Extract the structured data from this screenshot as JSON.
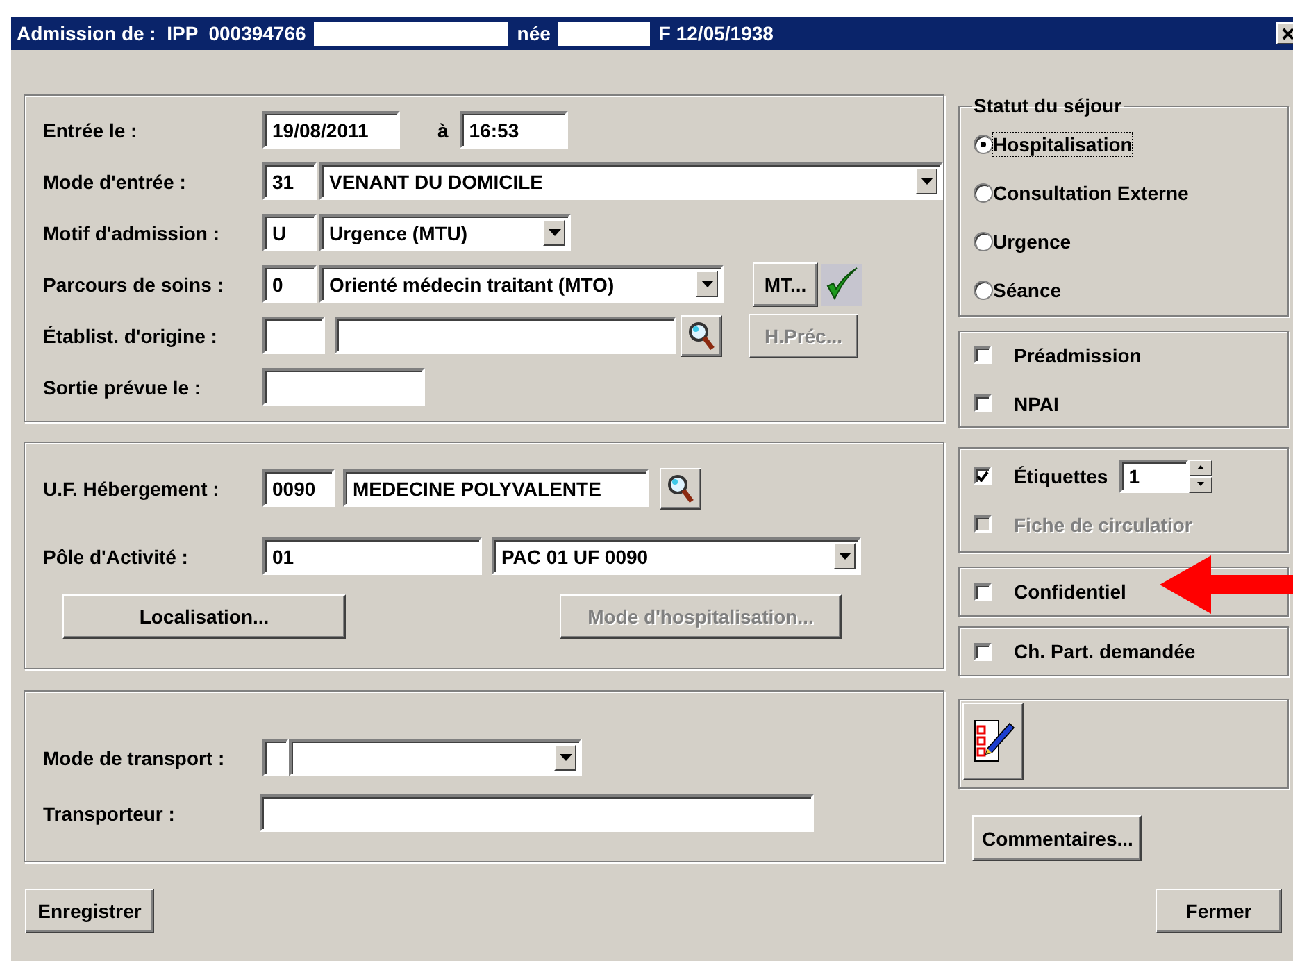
{
  "window": {
    "title": [
      {
        "kind": "text",
        "text": "Admission de :  IPP  000394766"
      },
      {
        "kind": "redacted"
      },
      {
        "kind": "text",
        "text": "née"
      },
      {
        "kind": "redacted"
      },
      {
        "kind": "text",
        "text": "F 12/05/1938"
      }
    ]
  },
  "admission_panel": {
    "rows": [
      {
        "kind": "datetime",
        "label": "Entrée le :",
        "date": "19/08/2011",
        "separator": "à",
        "time": "16:53"
      },
      {
        "kind": "code_combo",
        "label": "Mode d'entrée :",
        "code": "31",
        "value": "VENANT DU DOMICILE"
      },
      {
        "kind": "code_combo",
        "label": "Motif d'admission :",
        "code": "U",
        "value": "Urgence (MTU)"
      },
      {
        "kind": "code_combo",
        "label": "Parcours de soins :",
        "code": "0",
        "value": "Orienté médecin traitant (MTO)",
        "button": {
          "label": "MT...",
          "disabled": false
        },
        "validated": true
      },
      {
        "kind": "code_search",
        "label": "Établist. d'origine :",
        "button": {
          "label": "H.Préc...",
          "disabled": true
        }
      },
      {
        "kind": "field",
        "label": "Sortie prévue le :"
      }
    ]
  },
  "hebergement_panel": {
    "uf": {
      "label": "U.F. Hébergement :",
      "code": "0090",
      "value": "MEDECINE POLYVALENTE"
    },
    "pole": {
      "label": "Pôle d'Activité :",
      "code": "01",
      "value": "PAC 01 UF 0090"
    },
    "buttons": [
      {
        "label": "Localisation...",
        "disabled": false
      },
      {
        "label": "Mode d'hospitalisation...",
        "disabled": true
      }
    ]
  },
  "transport_panel": {
    "rows": [
      {
        "kind": "code_combo",
        "label": "Mode de transport :"
      },
      {
        "kind": "field",
        "label": "Transporteur :"
      }
    ]
  },
  "statut": {
    "legend": "Statut du séjour",
    "options": [
      {
        "label": "Hospitalisation",
        "selected": true
      },
      {
        "label": "Consultation Externe",
        "selected": false
      },
      {
        "label": "Urgence",
        "selected": false
      },
      {
        "label": "Séance",
        "selected": false
      }
    ]
  },
  "option_groups": [
    {
      "items": [
        {
          "label": "Préadmission",
          "checked": false,
          "disabled": false
        },
        {
          "label": "NPAI",
          "checked": false,
          "disabled": false
        }
      ]
    },
    {
      "items": [
        {
          "label": "Étiquettes",
          "checked": true,
          "disabled": false,
          "count": "1"
        },
        {
          "label": "Fiche de circulatior",
          "checked": false,
          "disabled": true
        }
      ]
    },
    {
      "items": [
        {
          "label": "Confidentiel",
          "checked": false,
          "disabled": false
        }
      ]
    },
    {
      "items": [
        {
          "label": "Ch. Part. demandée",
          "checked": false,
          "disabled": false
        }
      ]
    }
  ],
  "comments_button": "Commentaires...",
  "footer": {
    "save_button": "Enregistrer",
    "close_button": "Fermer"
  }
}
